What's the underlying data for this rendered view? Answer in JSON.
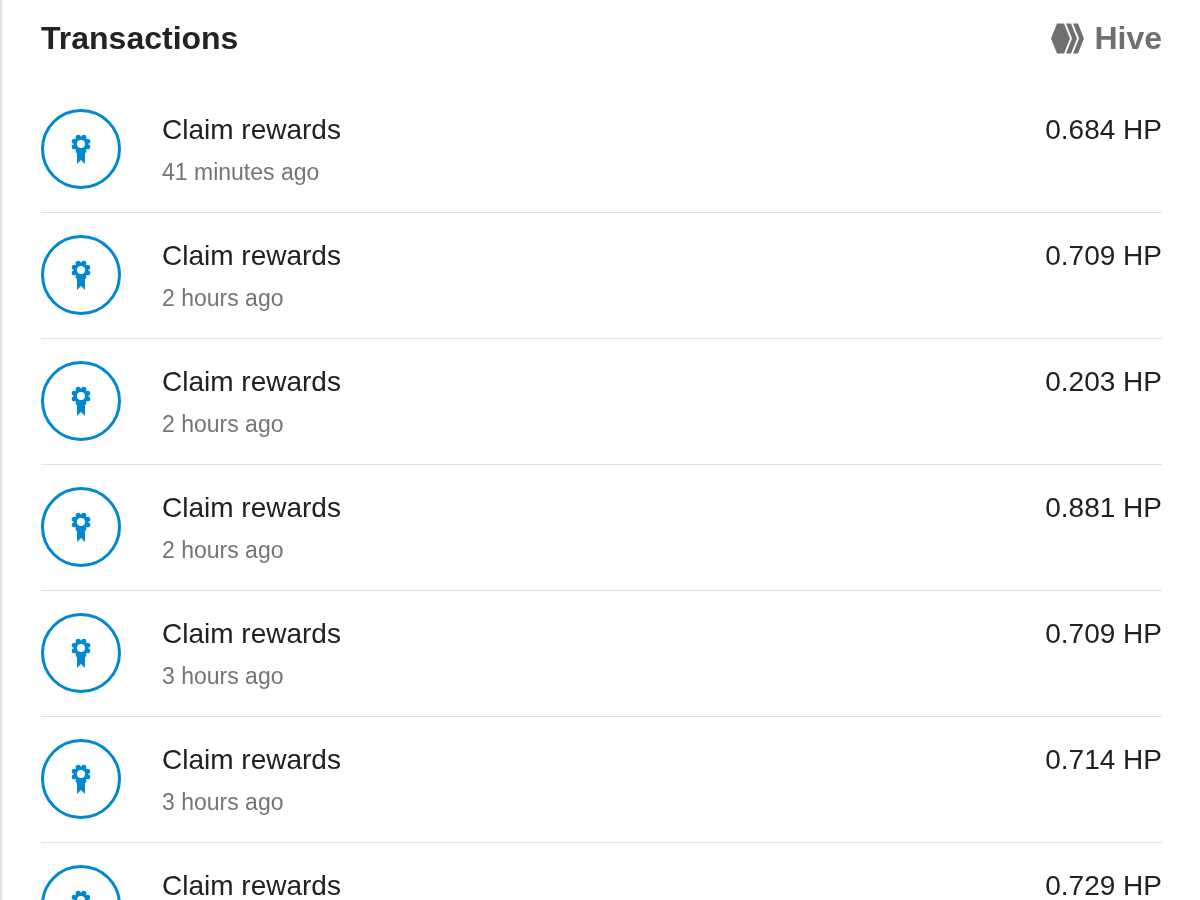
{
  "header": {
    "title": "Transactions",
    "brand": "Hive"
  },
  "transactions": [
    {
      "title": "Claim rewards",
      "time": "41 minutes ago",
      "amount": "0.684 HP"
    },
    {
      "title": "Claim rewards",
      "time": "2 hours ago",
      "amount": "0.709 HP"
    },
    {
      "title": "Claim rewards",
      "time": "2 hours ago",
      "amount": "0.203 HP"
    },
    {
      "title": "Claim rewards",
      "time": "2 hours ago",
      "amount": "0.881 HP"
    },
    {
      "title": "Claim rewards",
      "time": "3 hours ago",
      "amount": "0.709 HP"
    },
    {
      "title": "Claim rewards",
      "time": "3 hours ago",
      "amount": "0.714 HP"
    },
    {
      "title": "Claim rewards",
      "amount": "0.729 HP"
    }
  ]
}
